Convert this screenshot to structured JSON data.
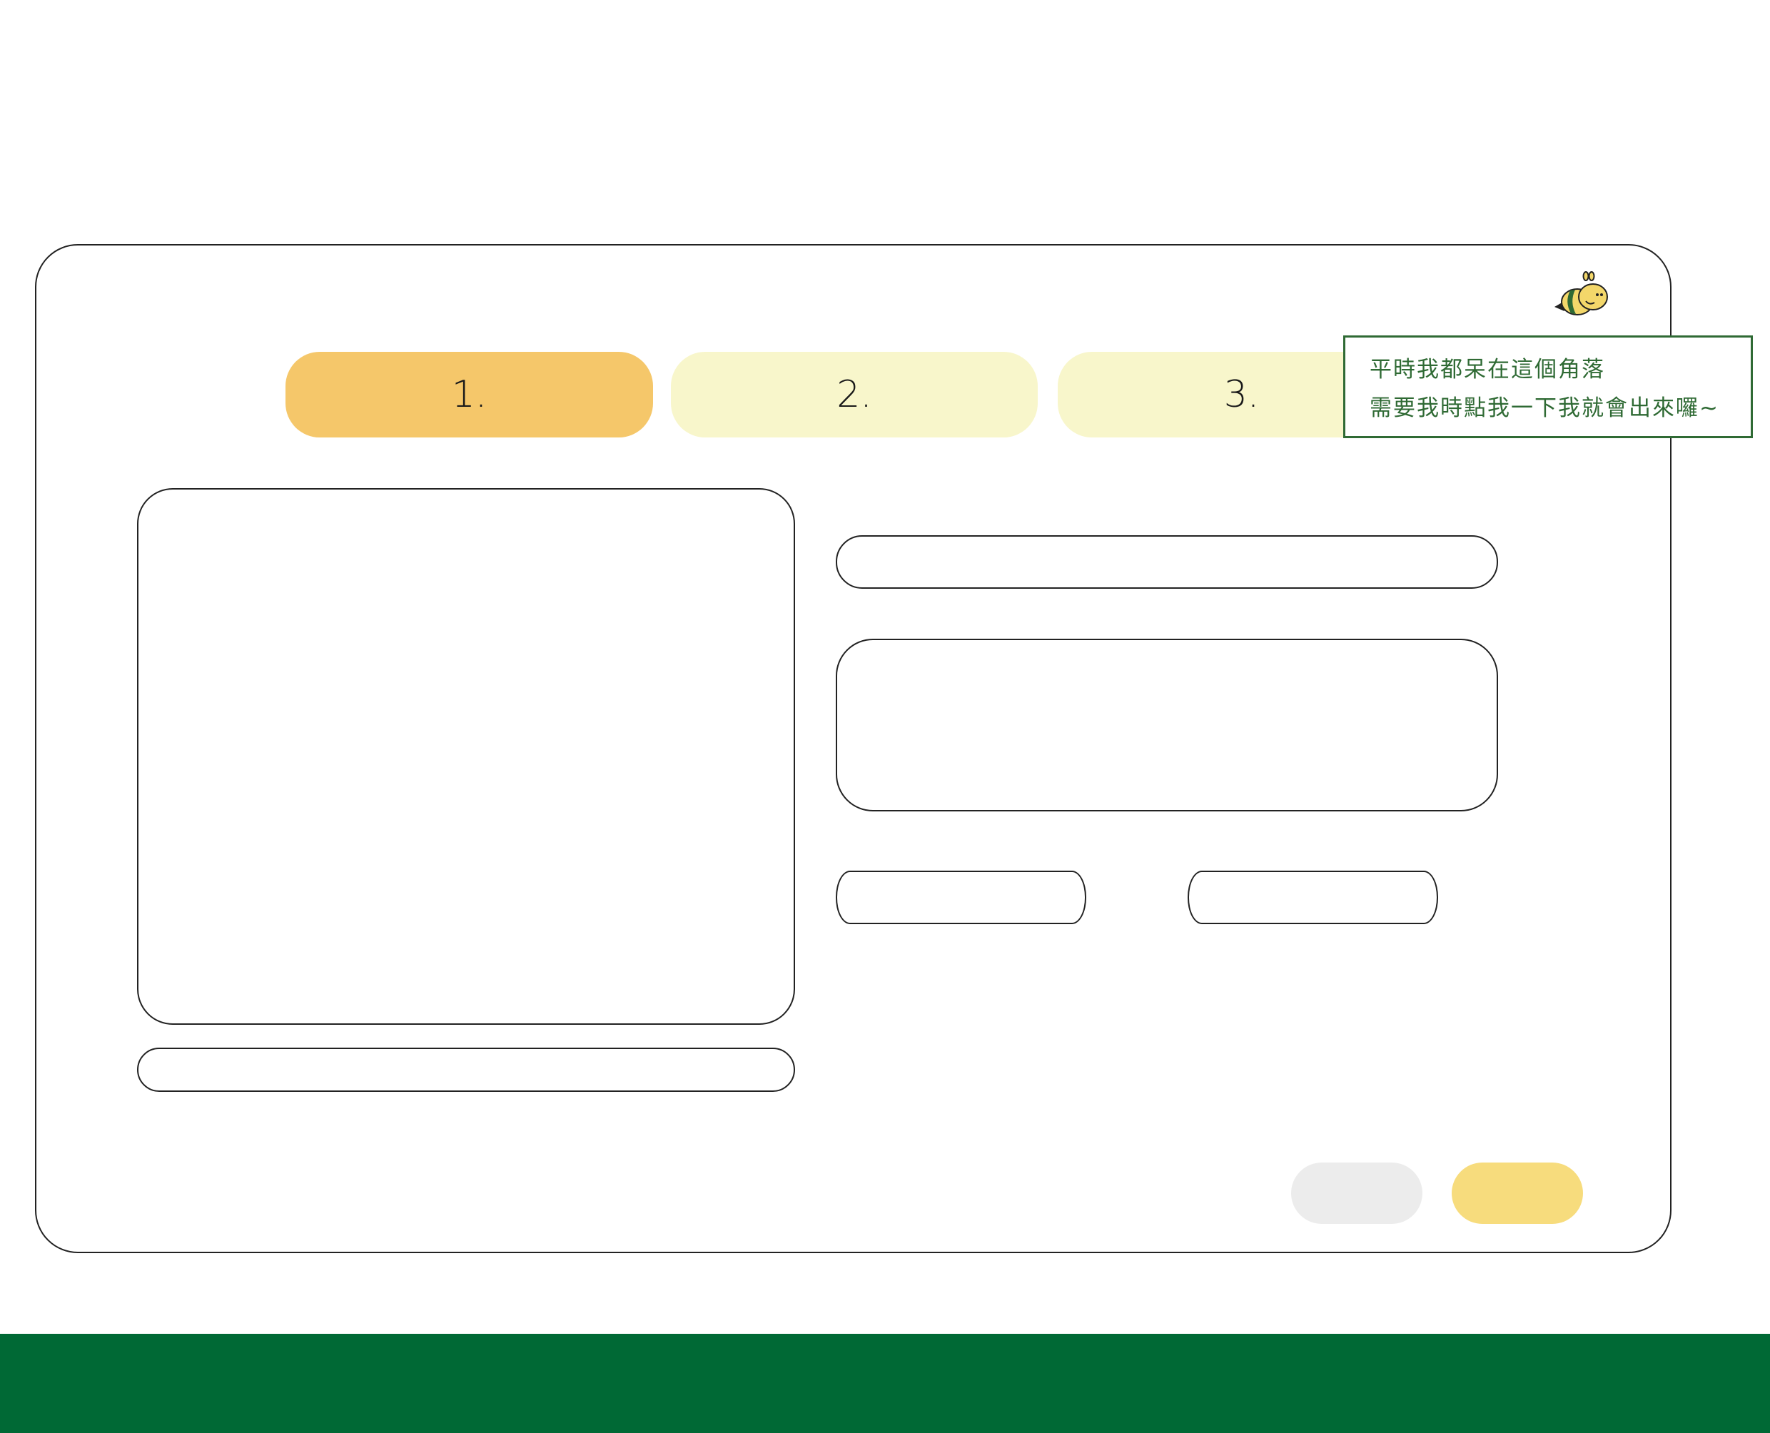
{
  "steps": [
    {
      "label": "1.",
      "state": "active"
    },
    {
      "label": "2.",
      "state": "inactive"
    },
    {
      "label": "3.",
      "state": "inactive"
    }
  ],
  "form": {
    "title_value": "",
    "description_value": "",
    "caption_value": "",
    "field_a_value": "",
    "field_b_value": ""
  },
  "actions": {
    "cancel_label": "",
    "next_label": ""
  },
  "helper": {
    "icon": "bee-icon",
    "tooltip_lines": [
      "平時我都呆在這個角落",
      "需要我時點我一下我就會出來囉~"
    ]
  },
  "colors": {
    "step_active": "#f5c76a",
    "step_inactive": "#f8f6cb",
    "primary_button": "#f7dc7d",
    "secondary_button": "#ececec",
    "brand_green": "#006935",
    "tooltip_text": "#2f6a34"
  }
}
